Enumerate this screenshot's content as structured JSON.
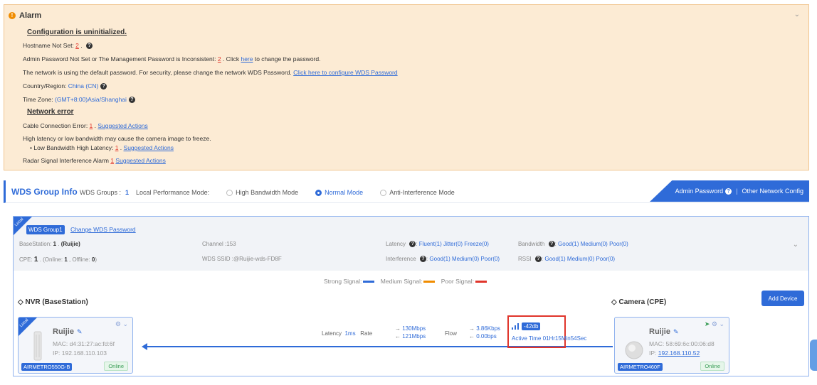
{
  "alarm": {
    "title": "Alarm",
    "config_header": "Configuration is uninitialized.",
    "hostname_label": "Hostname Not Set: ",
    "hostname_count": "2",
    "admin_label": "Admin Password Not Set or The Management Password is Inconsistent: ",
    "admin_count": "2",
    "admin_click": " . Click ",
    "admin_link": "here",
    "admin_tail": " to change the password.",
    "wds_default_text": "The network is using the default password. For security, please change the network WDS Password. ",
    "wds_default_link": "Click here to configure WDS Password",
    "country_label": "Country/Region: ",
    "country_value": "China (CN)",
    "timezone_label": "Time Zone: ",
    "timezone_value": "(GMT+8:00)Asia/Shanghai",
    "network_header": "Network error",
    "cable_label": "Cable Connection Error: ",
    "cable_count": "1",
    "suggested": "Suggested Actions",
    "latency_text": "High latency or low bandwidth may cause the camera image to freeze.",
    "lowbw_label": "Low Bandwidth High Latency: ",
    "lowbw_count": "1",
    "radar_label": "Radar Signal Interference Alarm ",
    "radar_count": "1"
  },
  "wds": {
    "title": "WDS Group Info",
    "groups_label": "WDS Groups :",
    "groups_count": "1",
    "mode_label": "Local Performance Mode:",
    "modes": [
      "High Bandwidth Mode",
      "Normal Mode",
      "Anti-Interference Mode"
    ],
    "selected_mode": "Normal Mode",
    "admin_btn": "Admin Password",
    "other_btn": "Other Network Config"
  },
  "group": {
    "corner": "Local",
    "tag": "WDS Group1",
    "change_link": "Change WDS Password",
    "basestation_label": "BaseStation:",
    "basestation_count": "1",
    "basestation_name": "(Ruijie)",
    "cpe_label": "CPE:",
    "cpe_count": "1",
    "cpe_detail_a": "(Online: ",
    "cpe_online": "1",
    "cpe_detail_b": " , Offline: ",
    "cpe_offline": "0",
    "cpe_detail_c": ")",
    "channel_label": "Channel :",
    "channel_value": "153",
    "ssid_label": "WDS SSID :",
    "ssid_value": "@Ruijie-wds-FD8F",
    "latency_label": "Latency",
    "latency_vals": "Fluent(1)  Jitter(0)  Freeze(0)",
    "interference_label": "Interference",
    "interference_vals": "Good(1)  Medium(0)  Poor(0)",
    "bandwidth_label": "Bandwidth",
    "bandwidth_vals": "Good(1)  Medium(0)  Poor(0)",
    "rssi_label": "RSSI",
    "rssi_vals": "Good(1)  Medium(0)  Poor(0)"
  },
  "legend": {
    "strong": "Strong Signal:",
    "medium": "Medium Signal:",
    "poor": "Poor Signal:",
    "colors": {
      "strong": "#2f6bd8",
      "medium": "#f08c00",
      "poor": "#e0352b"
    }
  },
  "nvr": {
    "title": "NVR (BaseStation)",
    "corner": "Local",
    "name": "Ruijie",
    "mac_label": "MAC: ",
    "mac": "d4:31:27:ac:fd:6f",
    "ip_label": "IP: ",
    "ip": "192.168.110.103",
    "model": "AIRMETRO550G-B",
    "status": "Online"
  },
  "camera": {
    "title": "Camera (CPE)",
    "name": "Ruijie",
    "mac_label": "MAC: ",
    "mac": "58:69:6c:00:06:d8",
    "ip_label": "IP: ",
    "ip": "192.168.110.52",
    "model": "AIRMETRO460F",
    "status": "Online"
  },
  "add_device": "Add Device",
  "link": {
    "latency_label": "Latency",
    "latency_value": "1ms",
    "rate_label": "Rate",
    "rate_up": "130Mbps",
    "rate_down": "121Mbps",
    "flow_label": "Flow",
    "flow_up": "3.86Kbps",
    "flow_down": "0.00bps",
    "rssi": "-42db",
    "active_time_label": "Active Time",
    "active_time": "01Hr15Min54Sec"
  }
}
